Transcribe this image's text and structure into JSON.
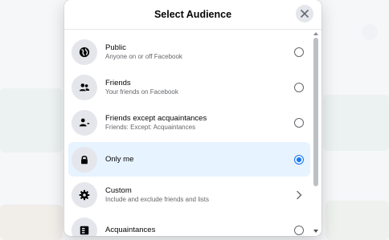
{
  "dialog": {
    "title": "Select Audience",
    "close_icon": "close-icon"
  },
  "options": [
    {
      "label": "Public",
      "description": "Anyone on or off Facebook",
      "icon": "globe-icon",
      "control": "radio",
      "selected": false
    },
    {
      "label": "Friends",
      "description": "Your friends on Facebook",
      "icon": "friends-icon",
      "control": "radio",
      "selected": false
    },
    {
      "label": "Friends except acquaintances",
      "description": "Friends: Except: Acquaintances",
      "icon": "friends-except-icon",
      "control": "radio",
      "selected": false
    },
    {
      "label": "Only me",
      "description": "",
      "icon": "lock-icon",
      "control": "radio",
      "selected": true
    },
    {
      "label": "Custom",
      "description": "Include and exclude friends and lists",
      "icon": "gear-icon",
      "control": "chevron",
      "selected": false
    },
    {
      "label": "Acquaintances",
      "description": "",
      "icon": "list-icon",
      "control": "radio",
      "selected": false
    }
  ],
  "colors": {
    "selected_background": "#e7f3ff",
    "accent": "#1877f2"
  }
}
